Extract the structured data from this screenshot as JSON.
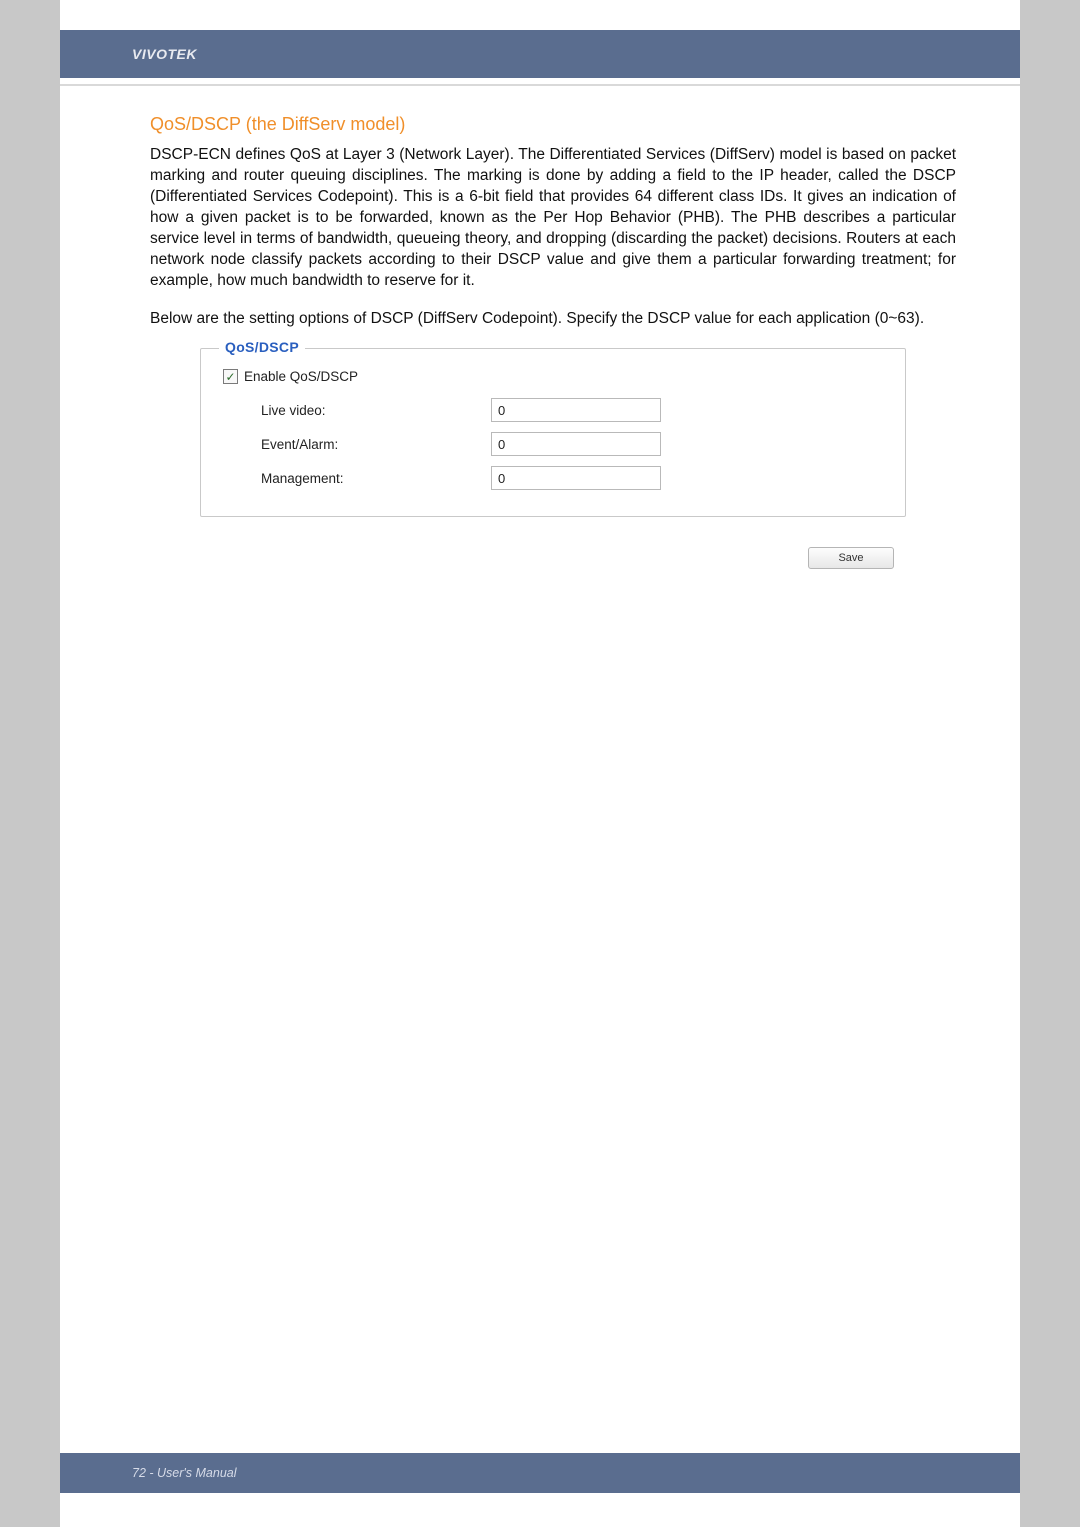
{
  "brand": "VIVOTEK",
  "section_title": "QoS/DSCP (the DiffServ model)",
  "paragraph1": "DSCP-ECN defines QoS at Layer 3 (Network Layer). The Differentiated Services (DiffServ) model is based on packet marking and router queuing disciplines. The marking is done by adding a field to the IP header, called the DSCP (Differentiated Services Codepoint). This is a 6-bit field that provides 64 different class IDs. It gives an indication of how a given packet is to be forwarded, known as the Per Hop Behavior (PHB). The PHB describes a particular service level in terms of bandwidth, queueing theory, and dropping (discarding the packet) decisions. Routers at each network node classify packets according to their DSCP value and give them a particular forwarding treatment; for example, how much bandwidth to reserve for it.",
  "paragraph2": "Below are the setting options of DSCP (DiffServ Codepoint). Specify the DSCP value for each application (0~63).",
  "fieldset": {
    "legend": "QoS/DSCP",
    "enable_label": "Enable QoS/DSCP",
    "enable_checked": true,
    "rows": [
      {
        "label": "Live video:",
        "value": "0"
      },
      {
        "label": "Event/Alarm:",
        "value": "0"
      },
      {
        "label": "Management:",
        "value": "0"
      }
    ]
  },
  "save_label": "Save",
  "footer": "72 - User's Manual"
}
